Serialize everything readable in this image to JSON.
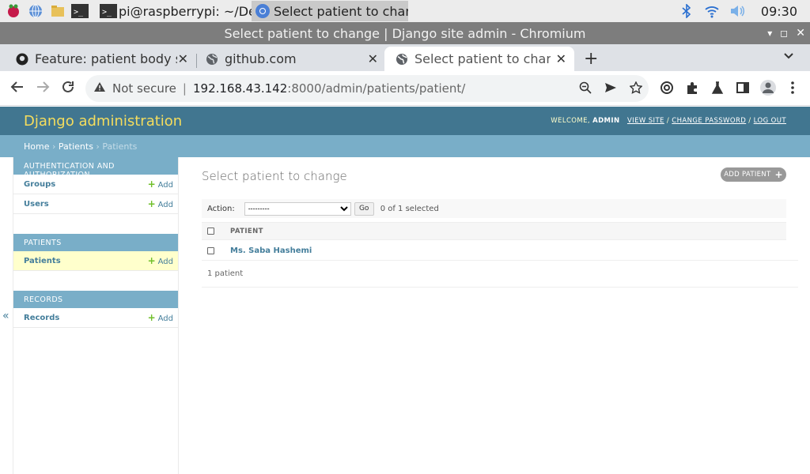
{
  "taskbar": {
    "tasks": [
      {
        "label": "pi@raspberrypi: ~/Des..."
      },
      {
        "label": "Select patient to chan..."
      }
    ],
    "clock": "09:30"
  },
  "window": {
    "title": "Select patient to change | Django site admin - Chromium"
  },
  "tabs": [
    {
      "title": "Feature: patient body ser"
    },
    {
      "title": "github.com"
    },
    {
      "title": "Select patient to change"
    }
  ],
  "toolbar": {
    "security": "Not secure",
    "url_host": "192.168.43.142",
    "url_path": ":8000/admin/patients/patient/"
  },
  "django": {
    "branding": "Django administration",
    "welcome": "WELCOME, ",
    "user": "ADMIN",
    "view_site": "VIEW SITE",
    "change_password": "CHANGE PASSWORD",
    "log_out": "LOG OUT",
    "slash": " / ",
    "breadcrumbs": {
      "home": "Home",
      "app": "Patients",
      "current": "Patients",
      "sep": " › "
    }
  },
  "sidebar": {
    "add_label": "Add",
    "modules": [
      {
        "caption": "AUTHENTICATION AND AUTHORIZATION",
        "items": [
          "Groups",
          "Users"
        ]
      },
      {
        "caption": "PATIENTS",
        "items": [
          "Patients"
        ]
      },
      {
        "caption": "RECORDS",
        "items": [
          "Records"
        ]
      }
    ],
    "collapse": "«"
  },
  "content": {
    "title": "Select patient to change",
    "add_button": "ADD PATIENT",
    "action_label": "Action:",
    "action_select": "---------",
    "go": "Go",
    "selected": "0 of 1 selected",
    "column": "PATIENT",
    "rows": [
      "Ms. Saba Hashemi"
    ],
    "count": "1 patient"
  }
}
